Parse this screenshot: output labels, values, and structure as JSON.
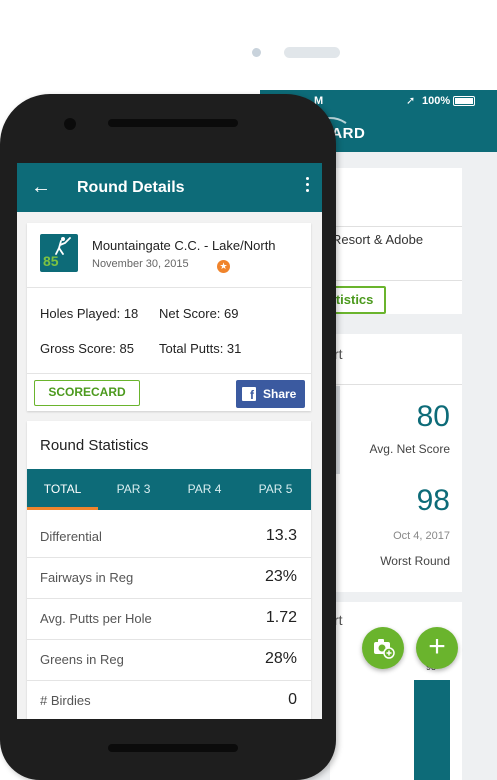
{
  "back_screen": {
    "status_time": "M",
    "status_battery": "100%",
    "logo_text": "CARD",
    "course_text": "Resort & Adobe",
    "view_statistics_label": "View Statistics",
    "chart_header": "rt",
    "avg_net_score_value": "80",
    "avg_net_score_label": "Avg. Net Score",
    "worst_round_value": "98",
    "worst_round_date": "Oct 4, 2017",
    "worst_round_label": "Worst Round",
    "second_chart_header": "rt",
    "bar_value": "98"
  },
  "fabs": {
    "add_symbol": "+"
  },
  "appbar": {
    "back_symbol": "←",
    "title": "Round Details"
  },
  "round": {
    "badge_score": "85",
    "course": "Mountaingate C.C. - Lake/North",
    "date": "November 30, 2015",
    "holes_played": "Holes Played: 18",
    "net_score": "Net Score: 69",
    "gross_score": "Gross Score: 85",
    "total_putts": "Total Putts: 31",
    "scorecard_label": "SCORECARD",
    "share_label": "Share",
    "fb_letter": "f"
  },
  "stats": {
    "title": "Round Statistics",
    "tabs": [
      "TOTAL",
      "PAR 3",
      "PAR 4",
      "PAR 5"
    ],
    "rows": [
      {
        "name": "Differential",
        "value": "13.3"
      },
      {
        "name": "Fairways in Reg",
        "value": "23%"
      },
      {
        "name": "Avg. Putts per Hole",
        "value": "1.72"
      },
      {
        "name": "Greens in Reg",
        "value": "28%"
      },
      {
        "name": "# Birdies",
        "value": "0"
      }
    ]
  },
  "colors": {
    "primary": "#0d6b78",
    "accent_green": "#6ab42d",
    "accent_orange": "#f0842c",
    "facebook": "#3b5aa0"
  }
}
